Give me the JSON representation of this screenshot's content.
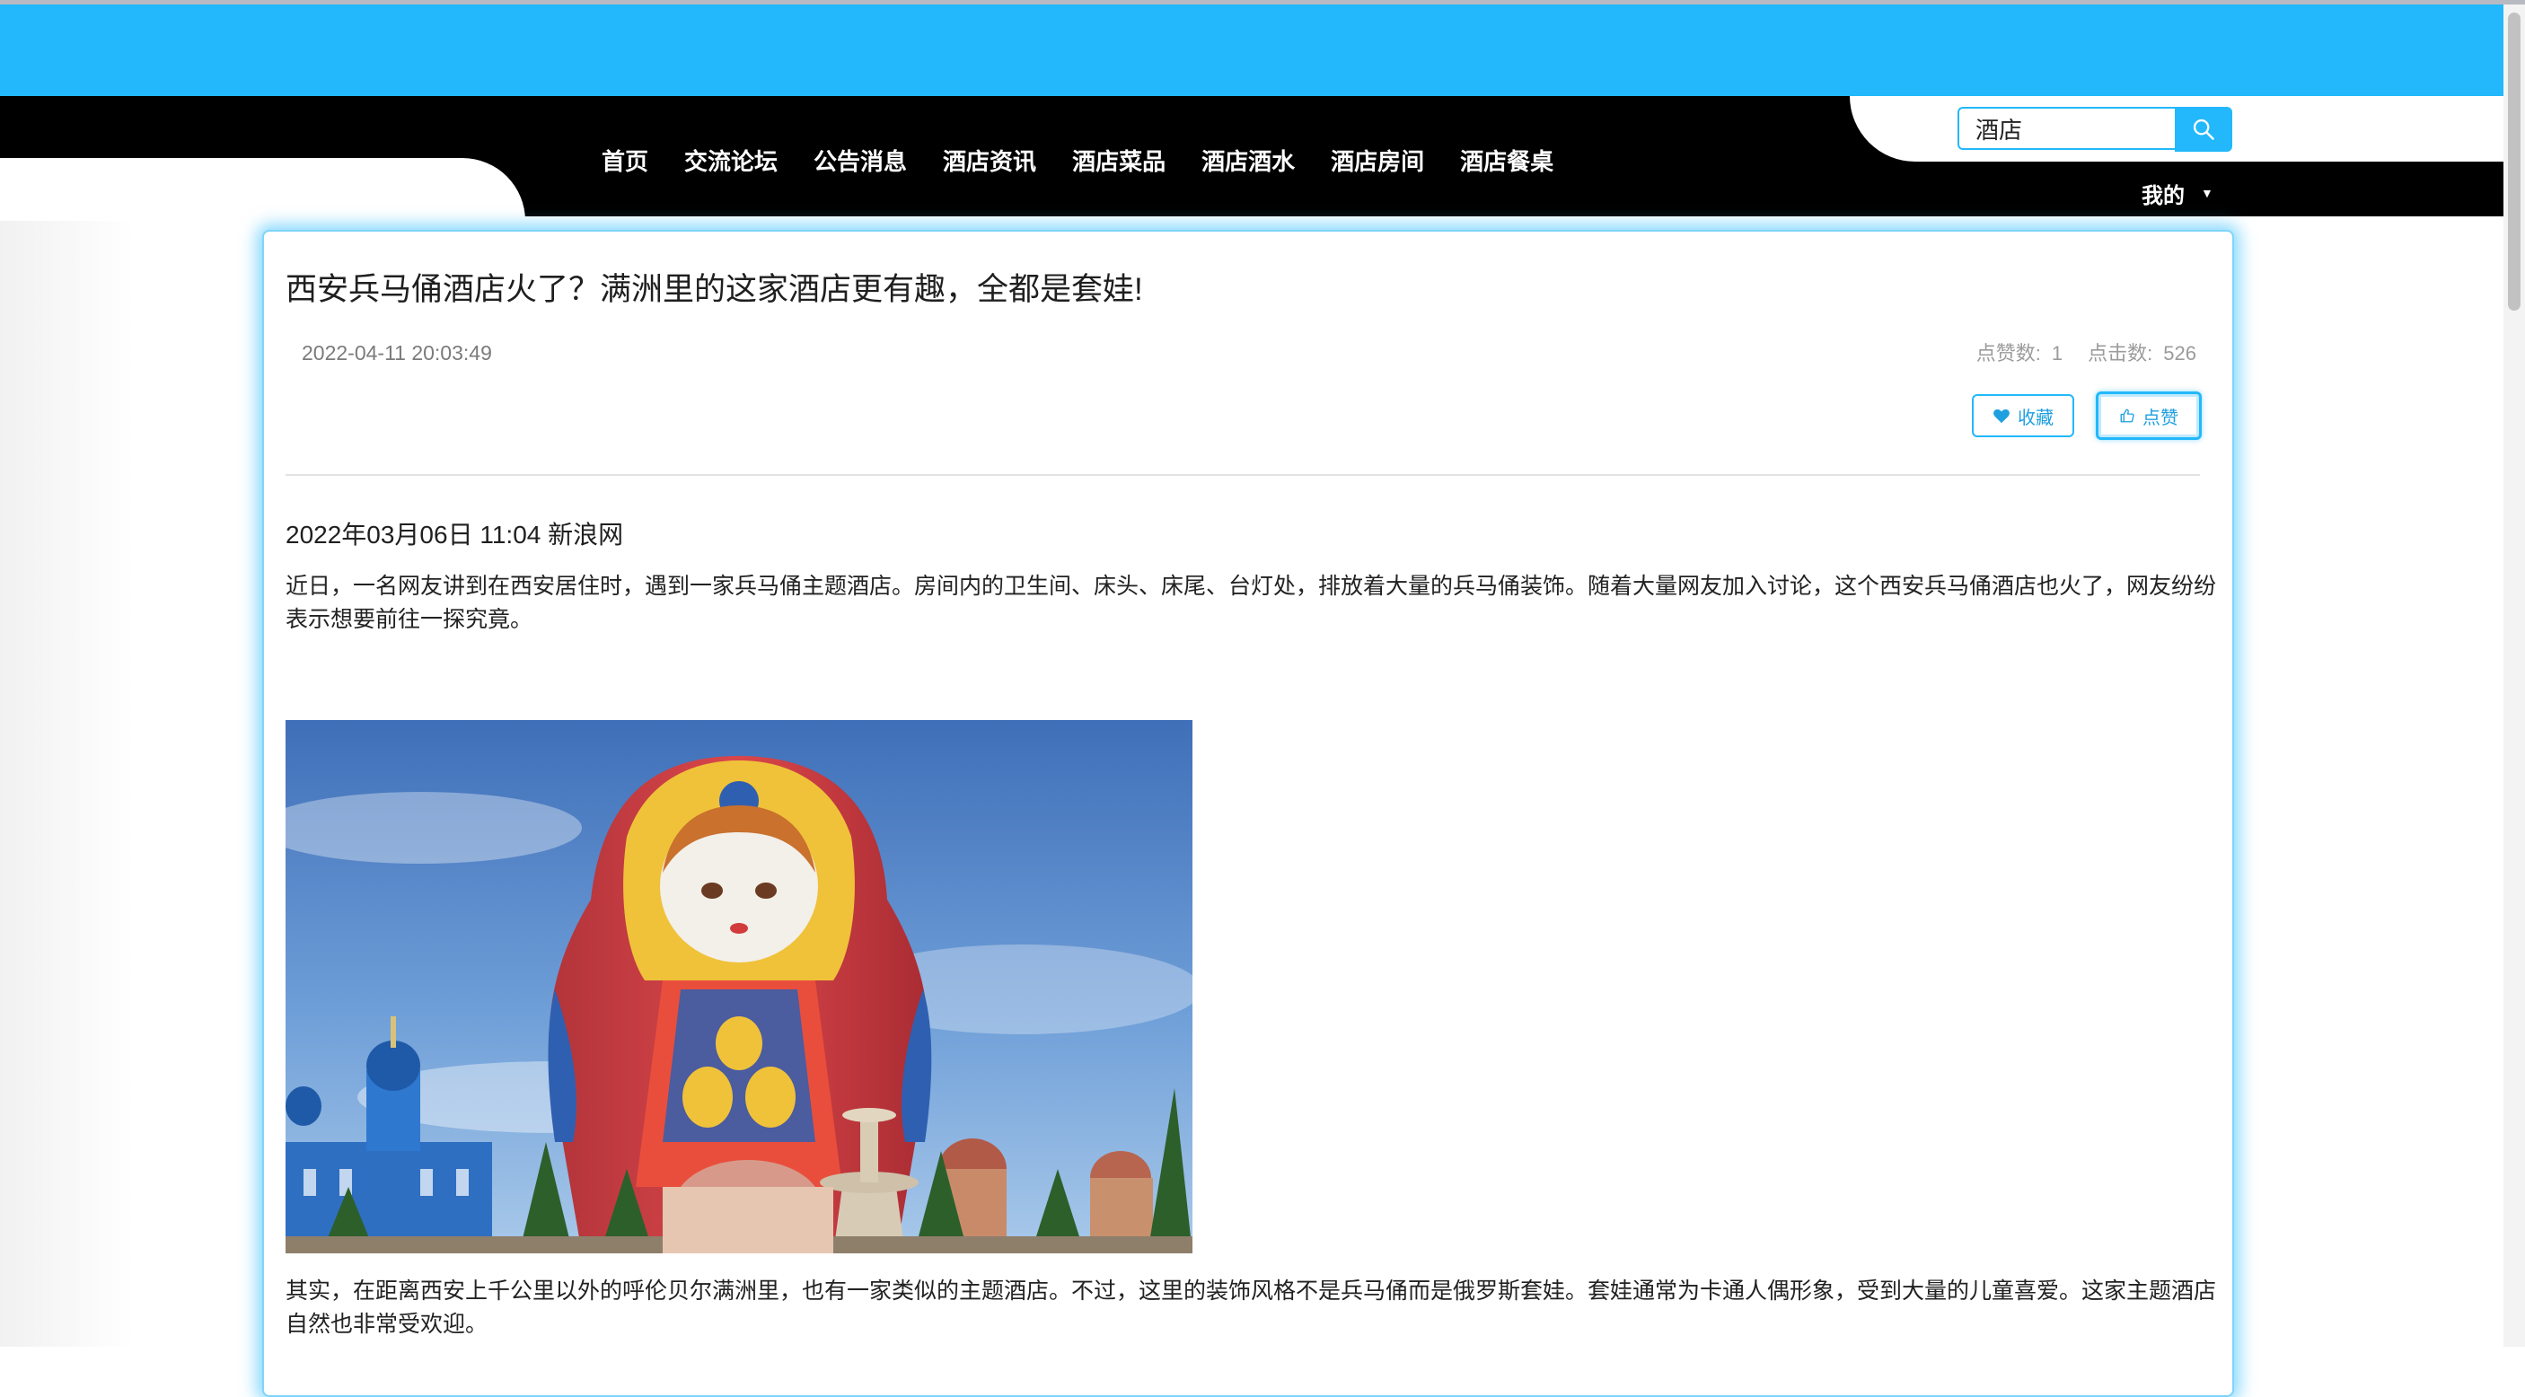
{
  "nav": {
    "items": [
      {
        "label": "首页"
      },
      {
        "label": "交流论坛"
      },
      {
        "label": "公告消息"
      },
      {
        "label": "酒店资讯"
      },
      {
        "label": "酒店菜品"
      },
      {
        "label": "酒店酒水"
      },
      {
        "label": "酒店房间"
      },
      {
        "label": "酒店餐桌"
      }
    ],
    "my_label": "我的"
  },
  "search": {
    "value": "酒店",
    "icon": "search-icon"
  },
  "article": {
    "title": "西安兵马俑酒店火了？满洲里的这家酒店更有趣，全都是套娃!",
    "datetime": "2022-04-11 20:03:49",
    "likes_label": "点赞数:",
    "likes_count": "1",
    "clicks_label": "点击数:",
    "clicks_count": "526",
    "favorite_label": "收藏",
    "like_label": "点赞",
    "source_line": "2022年03月06日 11:04 新浪网",
    "paragraph1": "近日，一名网友讲到在西安居住时，遇到一家兵马俑主题酒店。房间内的卫生间、床头、床尾、台灯处，排放着大量的兵马俑装饰。随着大量网友加入讨论，这个西安兵马俑酒店也火了，网友纷纷表示想要前往一探究竟。",
    "paragraph2": "其实，在距离西安上千公里以外的呼伦贝尔满洲里，也有一家类似的主题酒店。不过，这里的装饰风格不是兵马俑而是俄罗斯套娃。套娃通常为卡通人偶形象，受到大量的儿童喜爱。这家主题酒店自然也非常受欢迎。"
  },
  "colors": {
    "accent": "#22b8fb",
    "nav_bg": "#000000"
  }
}
